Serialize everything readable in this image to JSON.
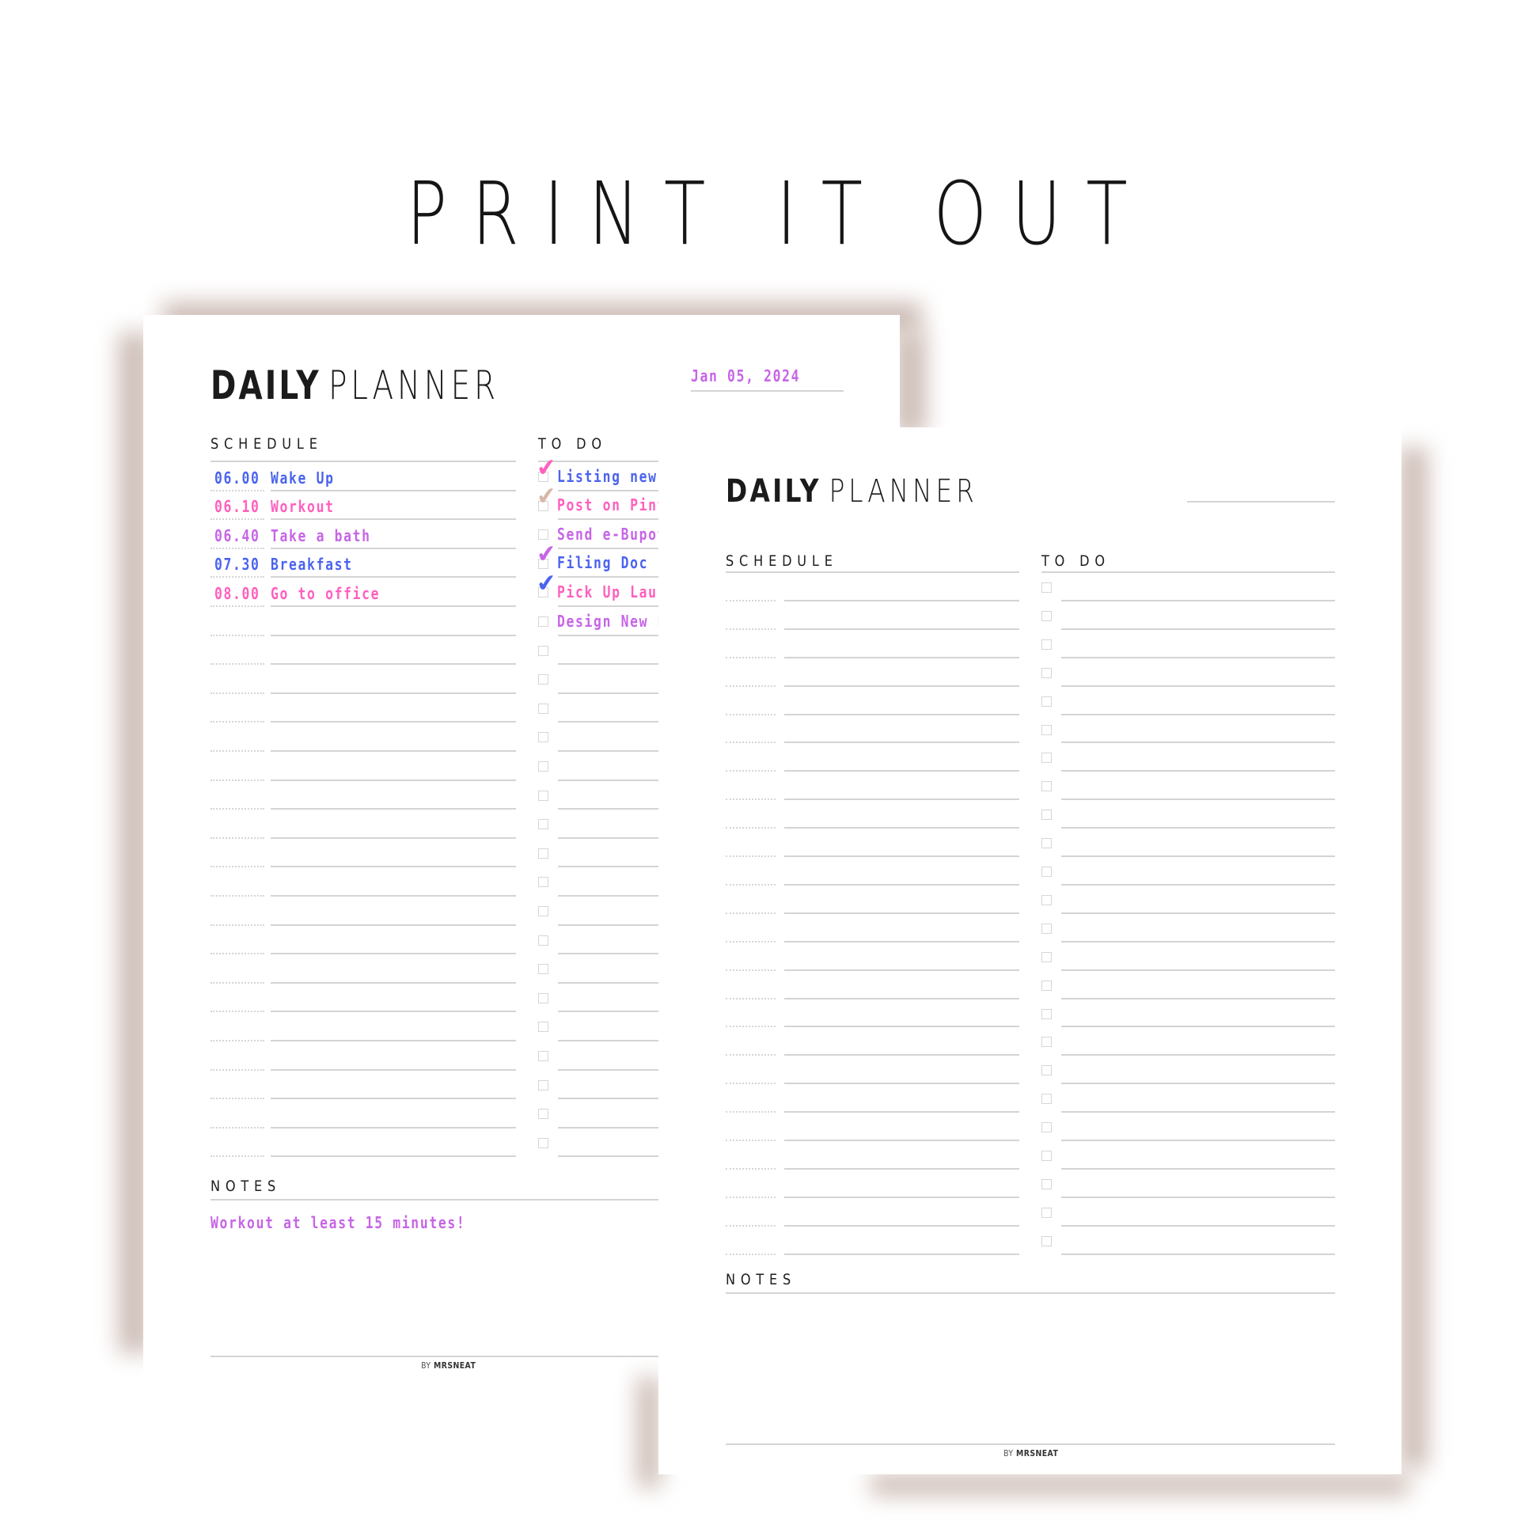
{
  "headline": "PRINT IT OUT",
  "colors": {
    "blue": "#4b63ee",
    "pink": "#ff5fbe",
    "purple": "#c665e6",
    "tan": "#d8b7a8",
    "shadow": "#cdbcb5",
    "ink": "#1b1b1b",
    "rule": "#d4d4d4"
  },
  "filled_planner": {
    "title_bold": "DAILY",
    "title_light": "PLANNER",
    "date": "Jan 05, 2024",
    "schedule_label": "SCHEDULE",
    "todo_label": "TO DO",
    "notes_label": "NOTES",
    "schedule": [
      {
        "time": "06.00",
        "task": "Wake Up",
        "color": "blue"
      },
      {
        "time": "06.10",
        "task": "Workout",
        "color": "pink"
      },
      {
        "time": "06.40",
        "task": "Take a bath",
        "color": "purple"
      },
      {
        "time": "07.30",
        "task": "Breakfast",
        "color": "blue"
      },
      {
        "time": "08.00",
        "task": "Go to office",
        "color": "pink"
      }
    ],
    "schedule_row_count": 24,
    "todos": [
      {
        "text": "Listing new it",
        "color": "blue",
        "checked": true,
        "check_color": "pink"
      },
      {
        "text": "Post on Pinte",
        "color": "pink",
        "checked": true,
        "check_color": "tan"
      },
      {
        "text": "Send e-Bupot",
        "color": "purple",
        "checked": false
      },
      {
        "text": "Filing Doc",
        "color": "blue",
        "checked": true,
        "check_color": "purple"
      },
      {
        "text": "Pick Up Laund",
        "color": "pink",
        "checked": true,
        "check_color": "blue"
      },
      {
        "text": "Design New Pl",
        "color": "purple",
        "checked": false
      }
    ],
    "todo_row_count": 24,
    "notes": "Workout at least 15 minutes!",
    "footer_by": "BY",
    "footer_brand": "MRSNEAT"
  },
  "blank_planner": {
    "title_bold": "DAILY",
    "title_light": "PLANNER",
    "date": "",
    "schedule_label": "SCHEDULE",
    "todo_label": "TO DO",
    "notes_label": "NOTES",
    "schedule_row_count": 24,
    "todo_row_count": 24,
    "footer_by": "BY",
    "footer_brand": "MRSNEAT"
  }
}
